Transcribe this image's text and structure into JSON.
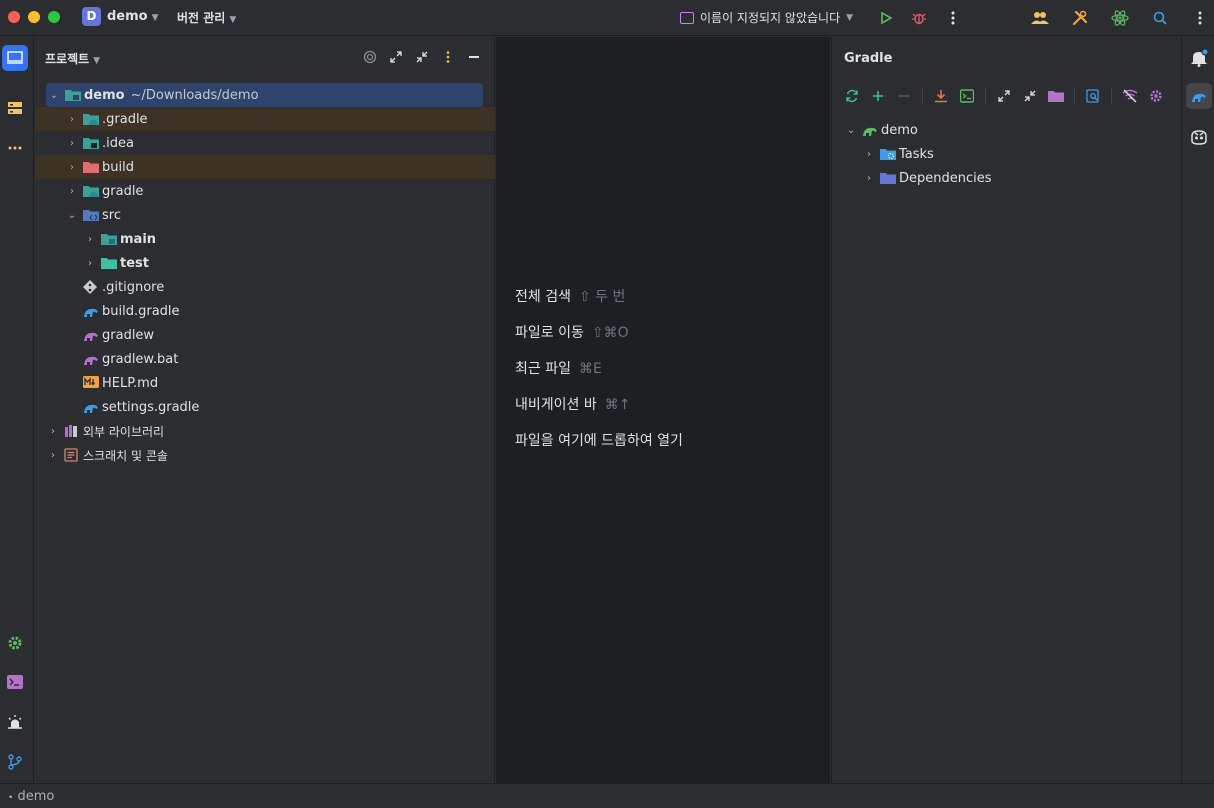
{
  "titlebar": {
    "project_badge": "D",
    "project_name": "demo",
    "vcs_label": "버전 관리",
    "run_config": "이름이 지정되지 않았습니다",
    "icons": [
      "run-icon",
      "debug-icon",
      "more-icon",
      "collab-icon",
      "build-tools-icon",
      "react-icon",
      "search-icon",
      "menu-icon"
    ]
  },
  "project_panel": {
    "title": "프로젝트",
    "root": {
      "name": "demo",
      "path": "~/Downloads/demo"
    },
    "items": [
      {
        "label": ".gradle"
      },
      {
        "label": ".idea"
      },
      {
        "label": "build"
      },
      {
        "label": "gradle"
      },
      {
        "label": "src"
      },
      {
        "label": "main"
      },
      {
        "label": "test"
      },
      {
        "label": ".gitignore"
      },
      {
        "label": "build.gradle"
      },
      {
        "label": "gradlew"
      },
      {
        "label": "gradlew.bat"
      },
      {
        "label": "HELP.md"
      },
      {
        "label": "settings.gradle"
      },
      {
        "label": "외부 라이브러리"
      },
      {
        "label": "스크래치 및 콘솔"
      }
    ]
  },
  "editor_hints": [
    {
      "label": "전체 검색",
      "shortcut": "⇧ 두 번"
    },
    {
      "label": "파일로 이동",
      "shortcut": "⇧⌘O"
    },
    {
      "label": "최근 파일",
      "shortcut": "⌘E"
    },
    {
      "label": "내비게이션 바",
      "shortcut": "⌘↑"
    },
    {
      "label": "파일을 여기에 드롭하여 열기",
      "shortcut": ""
    }
  ],
  "gradle_panel": {
    "title": "Gradle",
    "root": "demo",
    "children": [
      {
        "label": "Tasks"
      },
      {
        "label": "Dependencies"
      }
    ]
  },
  "statusbar": {
    "text": "demo"
  },
  "colors": {
    "accent": "#3574f0",
    "selection": "#2e436e",
    "excluded": "#3d3223"
  }
}
